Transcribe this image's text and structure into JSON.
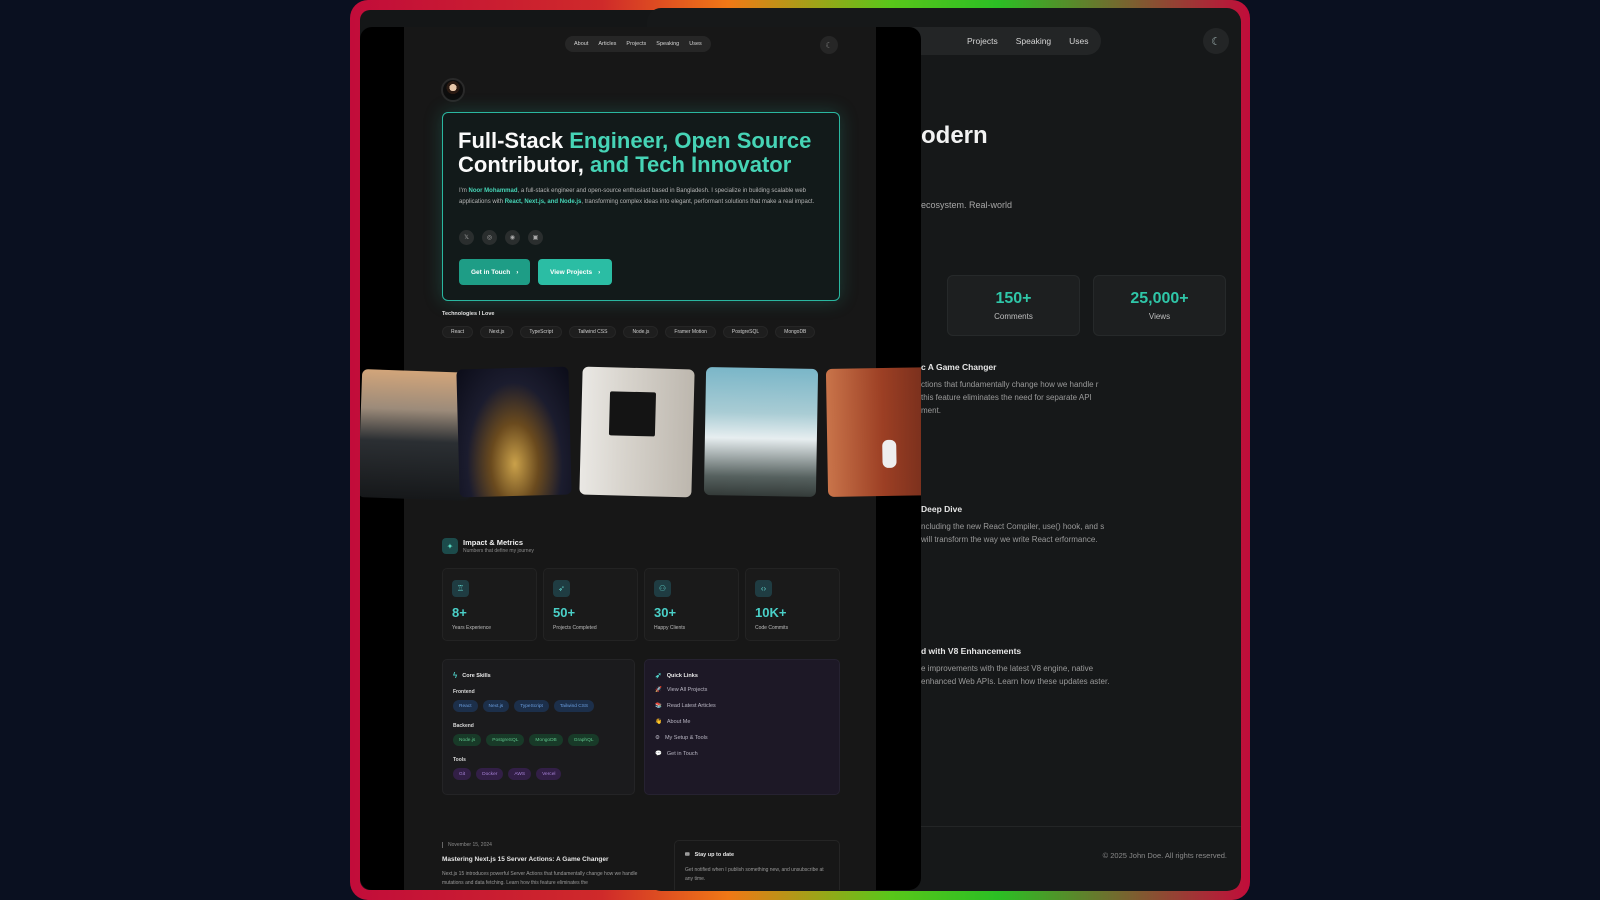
{
  "background_window": {
    "nav": [
      "Projects",
      "Speaking",
      "Uses"
    ],
    "heading_fragment": "odern",
    "sub_fragment": "ecosystem. Real-world",
    "stats": [
      {
        "value": "150+",
        "label": "Comments"
      },
      {
        "value": "25,000+",
        "label": "Views"
      }
    ],
    "articles": [
      {
        "title": "c A Game Changer",
        "desc": "ctions that fundamentally change how we handle r this feature eliminates the need for separate API ment."
      },
      {
        "title": "Deep Dive",
        "desc": "ncluding the new React Compiler, use() hook, and s will transform the way we write React erformance."
      },
      {
        "title": "d with V8 Enhancements",
        "desc": "e improvements with the latest V8 engine, native enhanced Web APIs. Learn how these updates aster."
      }
    ],
    "footer": "© 2025 John Doe. All rights reserved."
  },
  "nav": {
    "items": [
      "About",
      "Articles",
      "Projects",
      "Speaking",
      "Uses"
    ],
    "theme_icon": "theme-toggle-icon"
  },
  "hero": {
    "title_part1": "Full-Stack ",
    "title_accent1": "Engineer, Open Source",
    "title_part2": "Contributor,",
    "title_accent2": " and Tech Innovator",
    "desc_pre": "I'm ",
    "desc_name": "Noor Mohammad",
    "desc_mid": ", a full-stack engineer and open-source enthusiast based in Bangladesh. I specialize in building scalable web applications with ",
    "desc_tech": "React, Next.js, and Node.js",
    "desc_post": ", transforming complex ideas into elegant, performant solutions that make a real impact.",
    "socials": [
      "x-icon",
      "instagram-icon",
      "github-icon",
      "linkedin-icon"
    ],
    "primary_button": "Get in Touch",
    "secondary_button": "View Projects"
  },
  "technologies": {
    "label": "Technologies I Love",
    "items": [
      "React",
      "Next.js",
      "TypeScript",
      "Tailwind CSS",
      "Node.js",
      "Framer Motion",
      "PostgreSQL",
      "MongoDB"
    ]
  },
  "impact": {
    "title": "Impact & Metrics",
    "subtitle": "Numbers that define my journey",
    "metrics": [
      {
        "value": "8+",
        "label": "Years Experience",
        "icon": "award-icon"
      },
      {
        "value": "50+",
        "label": "Projects Completed",
        "icon": "rocket-icon"
      },
      {
        "value": "30+",
        "label": "Happy Clients",
        "icon": "users-icon"
      },
      {
        "value": "10K+",
        "label": "Code Commits",
        "icon": "code-icon"
      }
    ]
  },
  "skills": {
    "title": "Core Skills",
    "frontend_label": "Frontend",
    "frontend": [
      "React",
      "Next.js",
      "TypeScript",
      "Tailwind CSS"
    ],
    "backend_label": "Backend",
    "backend": [
      "Node.js",
      "PostgreSQL",
      "MongoDB",
      "GraphQL"
    ],
    "tools_label": "Tools",
    "tools": [
      "Git",
      "Docker",
      "AWS",
      "Vercel"
    ]
  },
  "quick_links": {
    "title": "Quick Links",
    "items": [
      "View All Projects",
      "Read Latest Articles",
      "About Me",
      "My Setup & Tools",
      "Get in Touch"
    ]
  },
  "article": {
    "date": "November 15, 2024",
    "title": "Mastering Next.js 15 Server Actions: A Game Changer",
    "desc": "Next.js 15 introduces powerful Server Actions that fundamentally change how we handle mutations and data fetching. Learn how this feature eliminates the"
  },
  "newsletter": {
    "title": "Stay up to date",
    "desc": "Get notified when I publish something new, and unsubscribe at any time."
  }
}
